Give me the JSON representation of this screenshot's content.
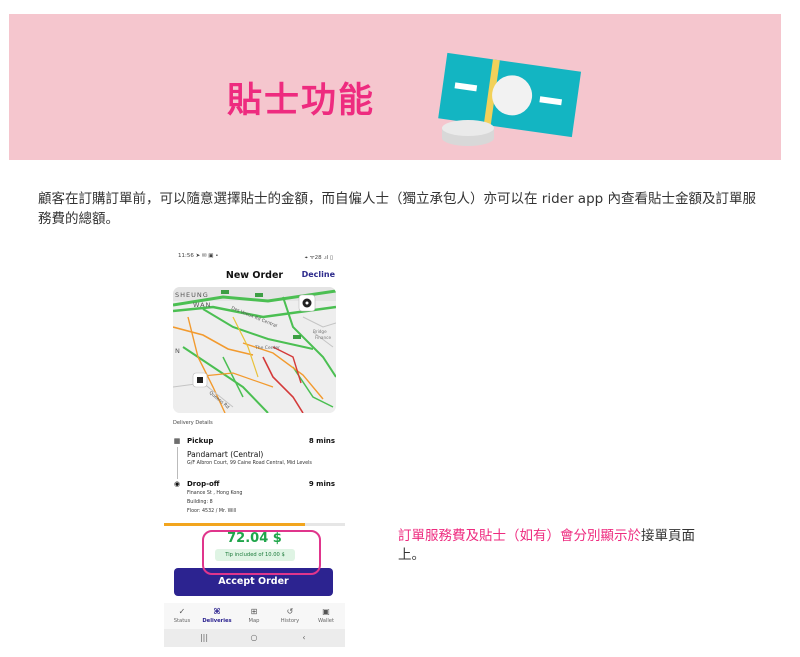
{
  "banner": {
    "title": "貼士功能",
    "background": "#f5c6ce",
    "accent": "#ee2b7f",
    "art_icon": "banknote-and-coins-icon"
  },
  "description": "顧客在訂購訂單前，可以隨意選擇貼士的金額，而自僱人士（獨立承包人）亦可以在 rider app 內查看貼士金額及訂單服務費的總額。",
  "phone": {
    "status_time": "11:56 ➤ ✉ ▣ •",
    "status_right": "⌖ ᯤ28 .ıl ▯",
    "header": {
      "title": "New Order",
      "decline_label": "Decline"
    },
    "map": {
      "labels": [
        "SHEUNG",
        "WAN",
        "Des Voeux Rd Central",
        "The Center",
        "Queens Rd",
        "Finance",
        "Bridge",
        "N"
      ]
    },
    "delivery_details_label": "Delivery Details",
    "pickup": {
      "label": "Pickup",
      "mins": "8 mins",
      "name": "Pandamart (Central)",
      "address": "G/F Albron Court, 99 Caine Road Central, Mid Levels"
    },
    "dropoff": {
      "label": "Drop-off",
      "mins": "9 mins",
      "lines": [
        "Finance St , Hong Kong",
        "Building: 8",
        "Floor: 4532 / Mr. Will"
      ]
    },
    "progress_fraction": 0.78,
    "price": "72.04 $",
    "tip_badge": "Tip included of 10.00 $",
    "accept_label": "Accept Order",
    "nav": [
      {
        "icon": "✓",
        "label": "Status",
        "active": false
      },
      {
        "icon": "⌘",
        "label": "Deliveries",
        "active": true
      },
      {
        "icon": "⊞",
        "label": "Map",
        "active": false
      },
      {
        "icon": "↺",
        "label": "History",
        "active": false
      },
      {
        "icon": "▣",
        "label": "Wallet",
        "active": false
      }
    ],
    "system_nav": [
      "|||",
      "○",
      "‹"
    ]
  },
  "note": {
    "pink_text": "訂單服務費及貼士（如有）會分別顯示於",
    "dark_text": "接單頁面上。"
  }
}
